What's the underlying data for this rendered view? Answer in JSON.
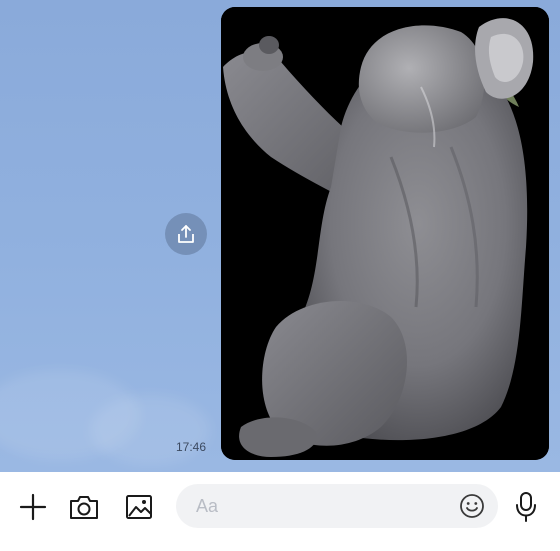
{
  "chat": {
    "message": {
      "timestamp": "17:46",
      "image_subject": "koala"
    }
  },
  "composer": {
    "placeholder": "Aa"
  },
  "icons": {
    "add": "plus-icon",
    "camera": "camera-icon",
    "gallery": "image-icon",
    "emoji": "smiley-icon",
    "voice": "microphone-icon",
    "share": "share-icon"
  },
  "colors": {
    "chat_background": "#8eaedd",
    "share_button": "#7590b8",
    "composer_background": "#ffffff",
    "input_background": "#f1f2f4"
  }
}
